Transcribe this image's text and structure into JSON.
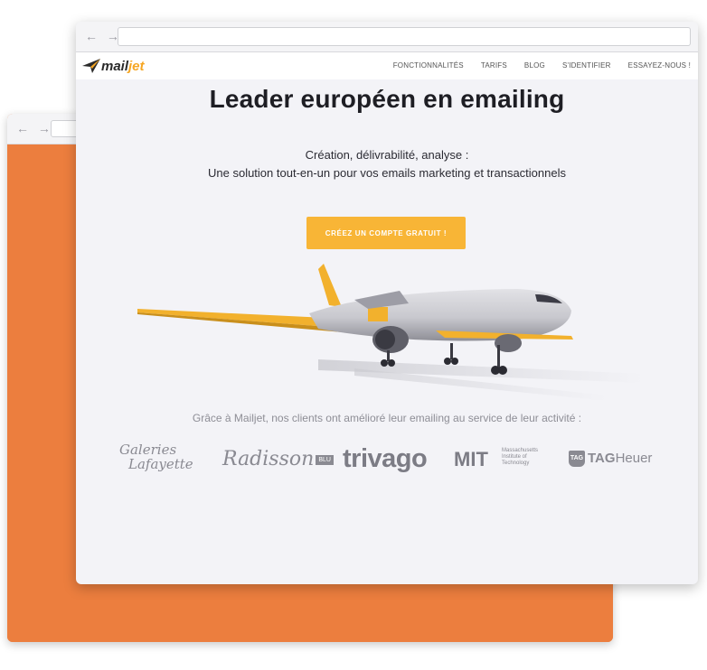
{
  "back_window": {
    "nav": "← →"
  },
  "front_window": {
    "nav": "← →",
    "site": {
      "logo": {
        "text_main": "mail",
        "text_accent": "jet",
        "icon": "paper-plane-icon"
      },
      "nav": [
        "FONCTIONNALITÉS",
        "TARIFS",
        "BLOG",
        "S'IDENTIFIER",
        "ESSAYEZ-NOUS !"
      ],
      "hero": {
        "title": "Leader européen en emailing",
        "subtitle_line1": "Création, délivrabilité, analyse :",
        "subtitle_line2": "Une solution tout-en-un pour vos emails marketing et transactionnels",
        "cta_label": "CRÉEZ UN COMPTE GRATUIT !"
      },
      "clients": {
        "intro": "Grâce à Mailjet, nos clients ont amélioré leur emailing au service de leur activité :",
        "logos": {
          "galeries_line1": "Galeries",
          "galeries_line2": "Lafayette",
          "radisson": "Radisson",
          "radisson_badge": "BLU",
          "trivago": "trivago",
          "mit": "MIT",
          "mit_small_1": "Massachusetts",
          "mit_small_2": "Institute of",
          "mit_small_3": "Technology",
          "tag_shield": "TAG",
          "tag_bold": "TAG",
          "tag_rest": "Heuer"
        }
      }
    }
  },
  "colors": {
    "orange_back": "#ec7e3e",
    "cta_yellow": "#f8b536",
    "plane_yellow": "#f2b12d",
    "page_bg": "#f3f3f7"
  }
}
